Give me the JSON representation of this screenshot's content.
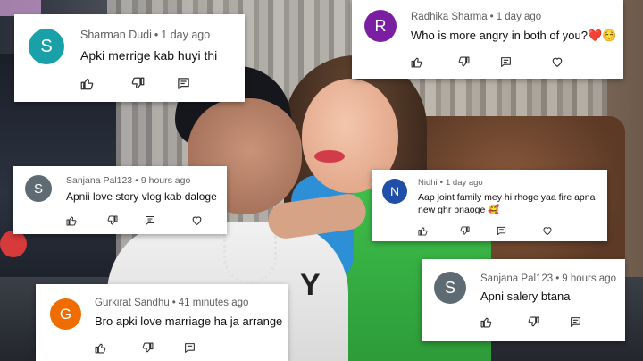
{
  "comments": [
    {
      "author": "Sharman Dudi",
      "time": "1 day ago",
      "text": "Apki merrige kab huyi thi",
      "initial": "S",
      "avatar_color": "#19a0a8"
    },
    {
      "author": "Radhika Sharma",
      "time": "1 day ago",
      "text": "Who is more angry in both of you?❤️☺️",
      "initial": "R",
      "avatar_color": "#7b1fa2"
    },
    {
      "author": "Sanjana Pal123",
      "time": "9 hours ago",
      "text": "Apnii love story vlog kab daloge",
      "initial": "S",
      "avatar_color": "#5f6b73"
    },
    {
      "author": "Nidhi",
      "time": "1 day ago",
      "text_line1": "Aap joint family mey hi rhoge yaa fire apna",
      "text_line2": "new ghr bnaoge 🥰",
      "initial": "N",
      "avatar_color": "#1f4fa8"
    },
    {
      "author": "Gurkirat Sandhu",
      "time": "41 minutes ago",
      "text": "Bro apki love marriage ha ja arrange",
      "initial": "G",
      "avatar_color": "#ef6c00"
    },
    {
      "author": "Sanjana Pal123",
      "time": "9 hours ago",
      "text": "Apni salery btana",
      "initial": "S",
      "avatar_color": "#5f6b73"
    }
  ],
  "icons": {
    "like": "thumb-up-icon",
    "dislike": "thumb-down-icon",
    "reply": "comment-icon",
    "heart": "heart-icon"
  },
  "separator": "•",
  "colors": {
    "meta": "#606060",
    "text": "#0f0f0f"
  }
}
